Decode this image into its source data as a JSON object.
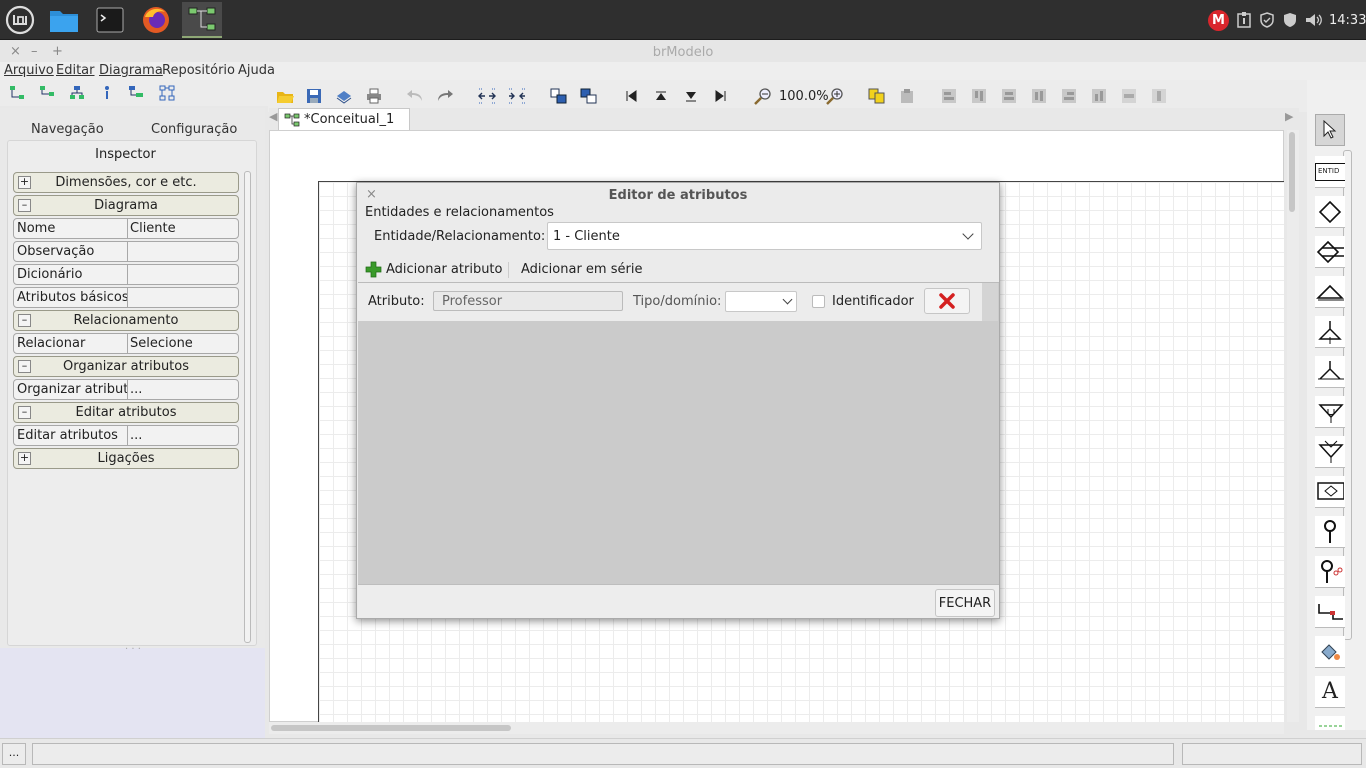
{
  "taskbar": {
    "tray_badge": "M",
    "clock": "14:33"
  },
  "window": {
    "title": "brModelo",
    "controls": [
      "×",
      "–",
      "+"
    ]
  },
  "menubar": {
    "items": [
      {
        "label": "Arquivo"
      },
      {
        "label": "Editar"
      },
      {
        "label": "Diagrama"
      },
      {
        "label": "Repositório"
      },
      {
        "label": "Ajuda"
      }
    ]
  },
  "toolbar": {
    "zoom": "100.0%"
  },
  "tabs": {
    "navegacao": "Navegação",
    "configuracao": "Configuração",
    "document_tab": "*Conceitual_1"
  },
  "inspector": {
    "title": "Inspector",
    "groups": {
      "dimensoes": {
        "sign": "+",
        "label": "Dimensões, cor e etc."
      },
      "diagrama": {
        "sign": "–",
        "label": "Diagrama"
      },
      "relacionamento": {
        "sign": "–",
        "label": "Relacionamento"
      },
      "organizar": {
        "sign": "–",
        "label": "Organizar atributos"
      },
      "editar": {
        "sign": "–",
        "label": "Editar atributos"
      },
      "ligacoes": {
        "sign": "+",
        "label": "Ligações"
      }
    },
    "rows": {
      "nome": {
        "key": "Nome",
        "value": "Cliente"
      },
      "observacao": {
        "key": "Observação",
        "value": ""
      },
      "dicionario": {
        "key": "Dicionário",
        "value": ""
      },
      "atributos_basicos": {
        "key": "Atributos básicos",
        "value": ""
      },
      "relacionar": {
        "key": "Relacionar",
        "value": "Selecione"
      },
      "organizar": {
        "key": "Organizar atributos",
        "value": "..."
      },
      "editar": {
        "key": "Editar atributos",
        "value": "..."
      }
    }
  },
  "dialog": {
    "close": "×",
    "title": "Editor de atributos",
    "section": "Entidades e relacionamentos",
    "entity_label": "Entidade/Relacionamento:",
    "entity_value": "1 - Cliente",
    "add_attribute": "Adicionar atributo",
    "add_series": "Adicionar em série",
    "attr_label": "Atributo:",
    "attr_value": "Professor",
    "type_label": "Tipo/domínio:",
    "type_value": "",
    "identifier_label": "Identificador",
    "identifier_checked": false,
    "close_button": "FECHAR"
  },
  "palette": {
    "entity_text": "ENTID",
    "text_tool": "A"
  },
  "statusbar": {
    "left": "..."
  },
  "colors": {
    "taskbar": "#2f2f2f",
    "delete_red": "#d42020",
    "add_green": "#3a9a2a",
    "mega_red": "#d9262c"
  }
}
